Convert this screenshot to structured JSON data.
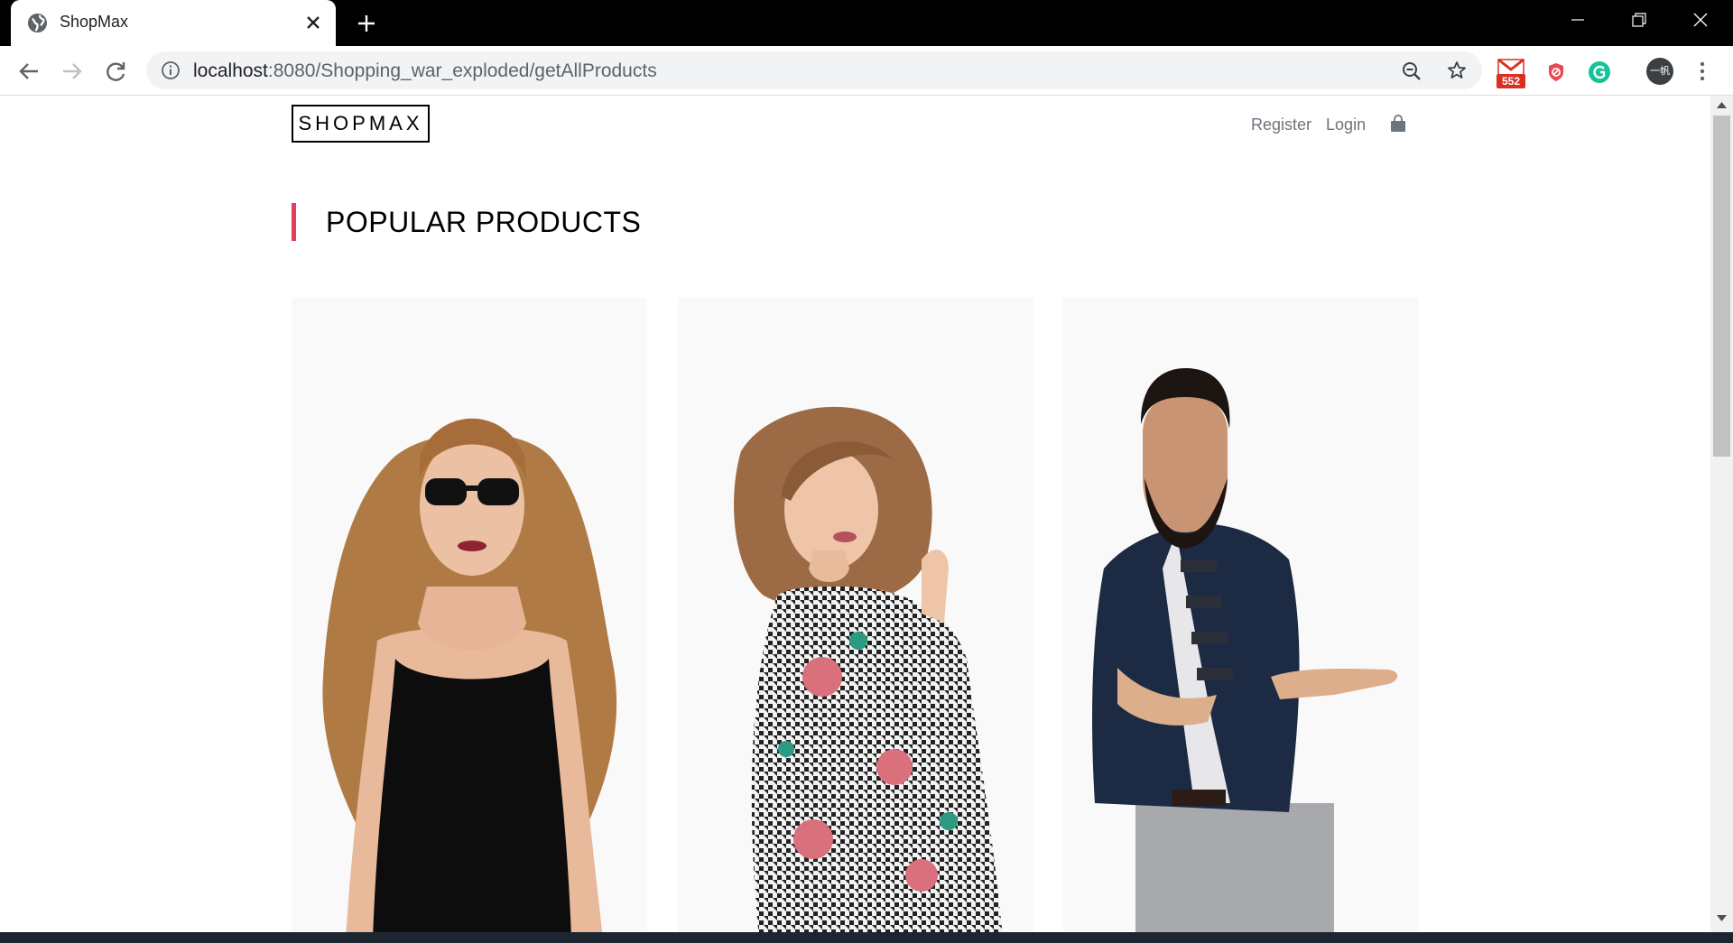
{
  "browser": {
    "tab_title": "ShopMax",
    "url_host": "localhost",
    "url_rest": ":8080/Shopping_war_exploded/getAllProducts",
    "gmail_count": "552",
    "profile_initials": "一帆"
  },
  "site": {
    "logo": "SHOPMAX",
    "nav": [
      {
        "label": "Register"
      },
      {
        "label": "Login"
      }
    ]
  },
  "section": {
    "title": "POPULAR PRODUCTS",
    "accent_color": "#e83e5e"
  },
  "products": [
    {
      "image": "woman-sunglasses-black-top"
    },
    {
      "image": "woman-floral-houndstooth-dress"
    },
    {
      "image": "man-navy-blazer-checked-shirt"
    }
  ]
}
